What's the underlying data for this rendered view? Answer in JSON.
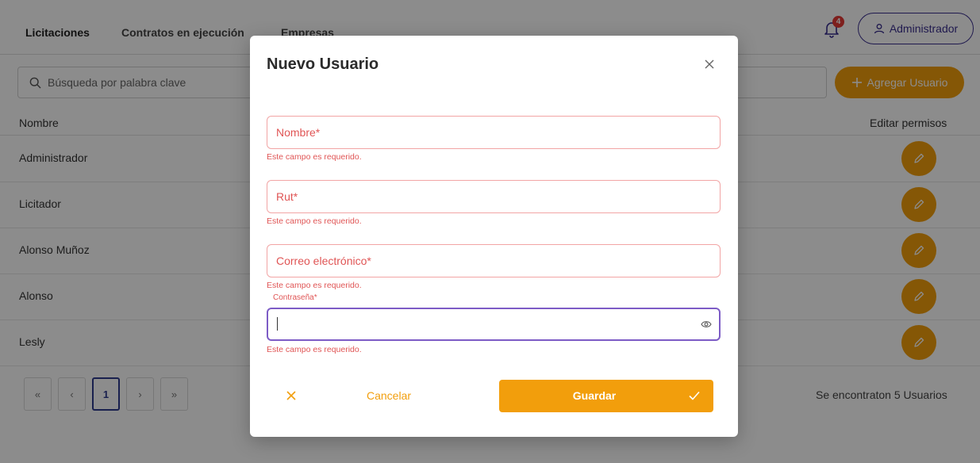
{
  "nav": {
    "tabs": [
      "Licitaciones",
      "Contratos en ejecución",
      "Empresas"
    ],
    "notification_count": "4",
    "user_label": "Administrador"
  },
  "toolbar": {
    "search_placeholder": "Búsqueda por palabra clave",
    "add_label": "Agregar Usuario"
  },
  "table": {
    "headers": [
      "Nombre",
      "Editar permisos"
    ],
    "rows": [
      "Administrador",
      "Licitador",
      "Alonso Muñoz",
      "Alonso",
      "Lesly"
    ]
  },
  "pagination": {
    "first": "«",
    "prev": "‹",
    "current": "1",
    "next": "›",
    "last": "»",
    "summary": "Se encontraton 5 Usuarios"
  },
  "modal": {
    "title": "Nuevo Usuario",
    "fields": [
      {
        "label": "Nombre*",
        "error": "Este campo es requerido."
      },
      {
        "label": "Rut*",
        "error": "Este campo es requerido."
      },
      {
        "label": "Correo electrónico*",
        "error": "Este campo es requerido."
      },
      {
        "label": "Contraseña*",
        "error": "Este campo es requerido."
      }
    ],
    "cancel_label": "Cancelar",
    "save_label": "Guardar"
  },
  "colors": {
    "accent": "#f29e0c",
    "brand": "#3a2f8f",
    "error": "#e05555",
    "focus": "#7d5cc6"
  },
  "icons": [
    "bell-icon",
    "user-icon",
    "search-icon",
    "plus-icon",
    "pencil-icon",
    "close-icon",
    "eye-icon",
    "check-icon"
  ]
}
